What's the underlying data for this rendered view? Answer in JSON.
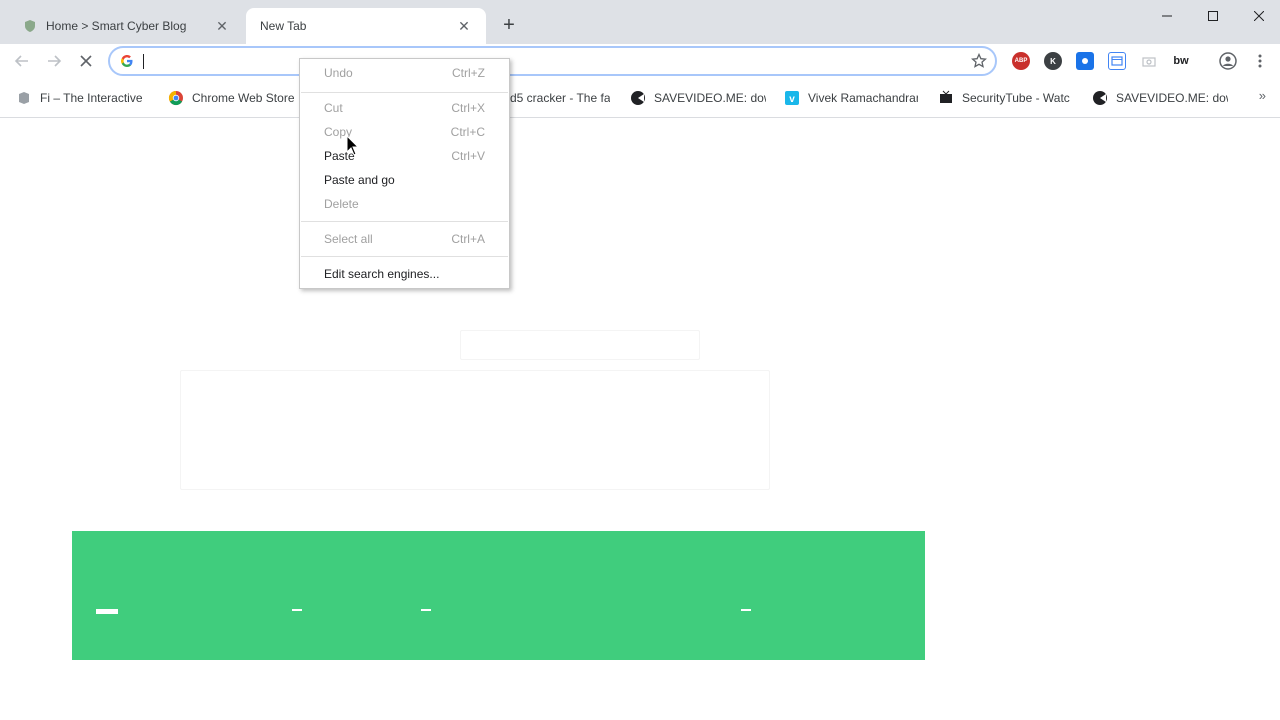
{
  "tabs": [
    {
      "title": "Home > Smart Cyber Blog",
      "active": false
    },
    {
      "title": "New Tab",
      "active": true
    }
  ],
  "omnibox": {
    "value": "",
    "placeholder": ""
  },
  "bookmarks": [
    {
      "label": "Fi – The Interactive F",
      "icon": "fi-icon"
    },
    {
      "label": "Chrome Web Store -",
      "icon": "chrome-icon"
    },
    {
      "label": "d5 cracker - The fa",
      "icon": "md5-icon"
    },
    {
      "label": "SAVEVIDEO.ME: dow",
      "icon": "savevideo-icon"
    },
    {
      "label": "Vivek Ramachandran",
      "icon": "vimeo-icon"
    },
    {
      "label": "SecurityTube - Watc",
      "icon": "tv-icon"
    },
    {
      "label": "SAVEVIDEO.ME: dow",
      "icon": "savevideo-icon"
    }
  ],
  "context_menu": {
    "items": [
      {
        "label": "Undo",
        "shortcut": "Ctrl+Z",
        "enabled": false
      },
      {
        "label": "Cut",
        "shortcut": "Ctrl+X",
        "enabled": false
      },
      {
        "label": "Copy",
        "shortcut": "Ctrl+C",
        "enabled": false
      },
      {
        "label": "Paste",
        "shortcut": "Ctrl+V",
        "enabled": true
      },
      {
        "label": "Paste and go",
        "shortcut": "",
        "enabled": true
      },
      {
        "label": "Delete",
        "shortcut": "",
        "enabled": false
      },
      {
        "label": "Select all",
        "shortcut": "Ctrl+A",
        "enabled": false
      },
      {
        "label": "Edit search engines...",
        "shortcut": "",
        "enabled": true
      }
    ]
  },
  "extensions": [
    {
      "name": "abp-icon",
      "text": "ABP",
      "color": "#c9302c"
    },
    {
      "name": "k-extension-icon",
      "text": "K",
      "color": "#3c4043"
    },
    {
      "name": "pushbullet-icon",
      "text": "",
      "color": "#1a73e8"
    },
    {
      "name": "window-extension-icon",
      "text": "",
      "color": "#4285f4"
    },
    {
      "name": "camera-extension-icon",
      "text": "",
      "color": "#bdc1c6"
    },
    {
      "name": "bw-extension-icon",
      "text": "bw",
      "color": "#202124"
    }
  ],
  "colors": {
    "banner": "#40cd7d",
    "tabstrip": "#dee1e6",
    "focus_ring": "#a8c7fa"
  }
}
